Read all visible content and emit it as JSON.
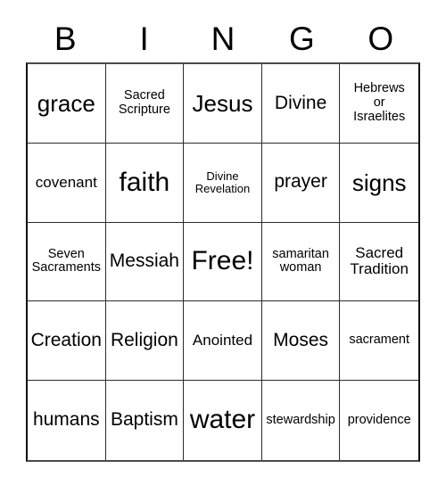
{
  "card": {
    "type": "bingo-card",
    "header": {
      "letters": [
        "B",
        "I",
        "N",
        "G",
        "O"
      ]
    },
    "grid": {
      "columns": 5,
      "rows": 5,
      "free_space": {
        "row": 3,
        "column": 3,
        "label": "Free!"
      },
      "cells": [
        {
          "text": "grace",
          "size": "fs-lg"
        },
        {
          "text": "Sacred\nScripture",
          "size": "fs-xs"
        },
        {
          "text": "Jesus",
          "size": "fs-lg"
        },
        {
          "text": "Divine",
          "size": "fs-md"
        },
        {
          "text": "Hebrews\nor\nIsraelites",
          "size": "fs-xs"
        },
        {
          "text": "covenant",
          "size": "fs-sm"
        },
        {
          "text": "faith",
          "size": "fs-xl"
        },
        {
          "text": "Divine\nRevelation",
          "size": "fs-xxs"
        },
        {
          "text": "prayer",
          "size": "fs-md"
        },
        {
          "text": "signs",
          "size": "fs-lg"
        },
        {
          "text": "Seven\nSacraments",
          "size": "fs-xs"
        },
        {
          "text": "Messiah",
          "size": "fs-md"
        },
        {
          "text": "Free!",
          "size": "fs-xl"
        },
        {
          "text": "samaritan\nwoman",
          "size": "fs-xs"
        },
        {
          "text": "Sacred\nTradition",
          "size": "fs-sm"
        },
        {
          "text": "Creation",
          "size": "fs-md"
        },
        {
          "text": "Religion",
          "size": "fs-md"
        },
        {
          "text": "Anointed",
          "size": "fs-sm"
        },
        {
          "text": "Moses",
          "size": "fs-md"
        },
        {
          "text": "sacrament",
          "size": "fs-xs"
        },
        {
          "text": "humans",
          "size": "fs-md"
        },
        {
          "text": "Baptism",
          "size": "fs-md"
        },
        {
          "text": "water",
          "size": "fs-xl"
        },
        {
          "text": "stewardship",
          "size": "fs-xs"
        },
        {
          "text": "providence",
          "size": "fs-xs"
        }
      ]
    },
    "colors": {
      "background": "#ffffff",
      "text": "#000000",
      "grid_line": "#2b2b2b",
      "outer_border": "#111111"
    }
  }
}
